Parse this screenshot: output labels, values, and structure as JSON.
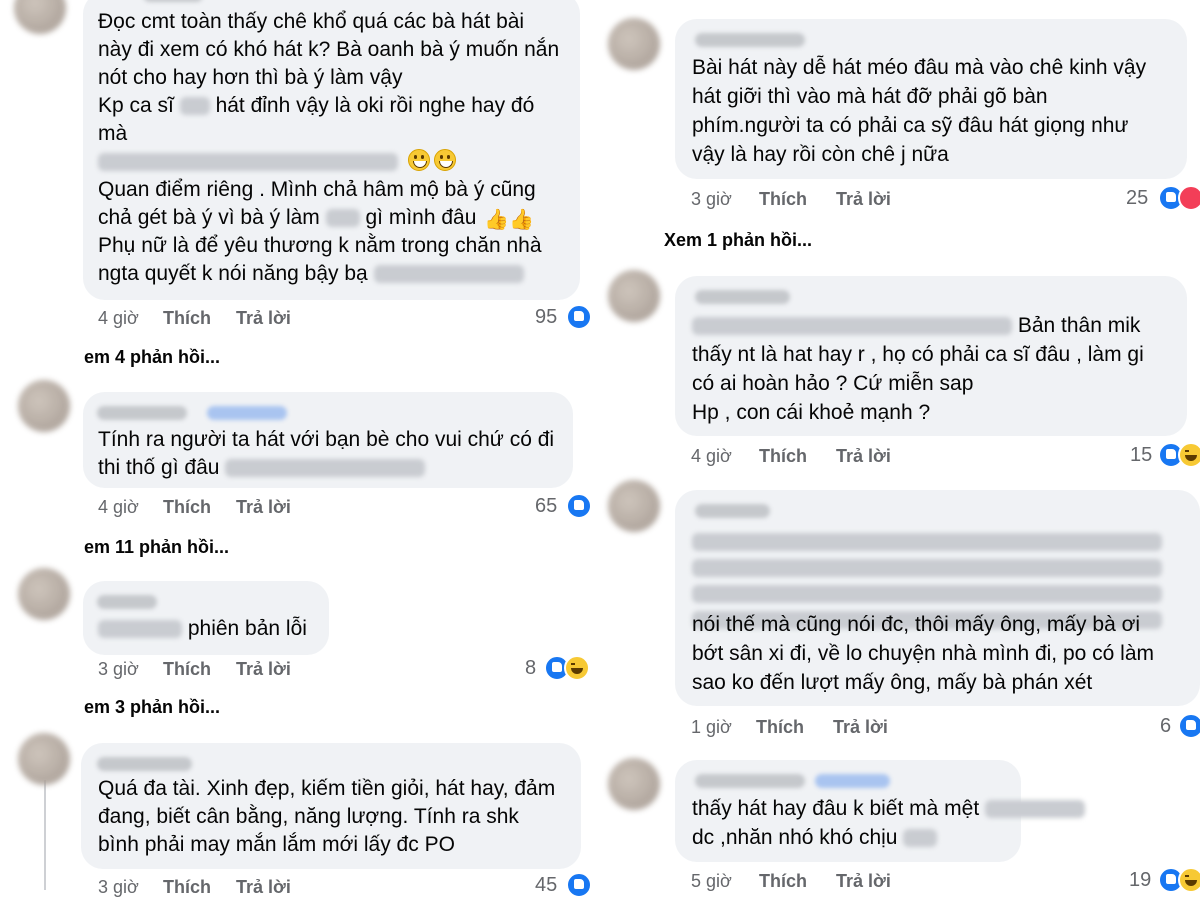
{
  "left": {
    "comments": [
      {
        "lines": [
          "Đọc cmt toàn thấy chê khổ quá các bà hát bài",
          "này đi xem có khó hát k? Bà oanh bà ý muốn nắn",
          "nót cho hay hơn thì bà ý làm vậy",
          "Kp ca sĩ",
          "hát đỉnh vậy là oki rồi nghe hay đó",
          "mà",
          "Quan điểm riêng . Mình chả hâm mộ bà ý cũng",
          "chả gét bà ý vì bà ý làm",
          "gì mình đâu",
          "Phụ nữ là để yêu thương k nằm trong chăn nhà",
          "ngta quyết k nói năng bậy bạ"
        ],
        "time": "4 giờ",
        "like": "Thích",
        "reply": "Trả lời",
        "reactions": "95",
        "more_replies": "em 4 phản hồi..."
      },
      {
        "lines": [
          "Tính ra người ta hát với bạn bè cho vui chứ có đi",
          "thi thố gì đâu"
        ],
        "time": "4 giờ",
        "like": "Thích",
        "reply": "Trả lời",
        "reactions": "65",
        "more_replies": "em 11 phản hồi..."
      },
      {
        "lines": [
          "phiên bản lỗi"
        ],
        "time": "3 giờ",
        "like": "Thích",
        "reply": "Trả lời",
        "reactions": "8",
        "more_replies": "em 3 phản hồi..."
      },
      {
        "lines": [
          "Quá đa tài. Xinh đẹp, kiếm tiền giỏi, hát hay, đảm",
          "đang, biết cân bằng, năng lượng. Tính ra shk",
          "bình phải may mắn lắm mới lấy đc PO"
        ],
        "time": "3 giờ",
        "like": "Thích",
        "reply": "Trả lời",
        "reactions": "45"
      }
    ]
  },
  "right": {
    "comments": [
      {
        "lines": [
          "Bài hát này dễ hát méo đâu mà vào chê kinh vậy",
          "hát giỡi thì vào mà hát đỡ phải gõ bàn",
          "phím.người ta có phải ca sỹ đâu hát  giọng như",
          "vậy là hay rồi còn chê j nữa"
        ],
        "time": "3 giờ",
        "like": "Thích",
        "reply": "Trả lời",
        "reactions": "25",
        "more_replies": "Xem 1 phản hồi..."
      },
      {
        "lines": [
          "Bản thân mik",
          "thấy nt là hat hay r , họ có phải ca sĩ đâu , làm gi",
          "có ai hoàn hảo ? Cứ miễn sap",
          "Hp , con cái khoẻ mạnh ?"
        ],
        "time": "4 giờ",
        "like": "Thích",
        "reply": "Trả lời",
        "reactions": "15"
      },
      {
        "lines": [
          "nói thế mà cũng nói đc, thôi mấy ông, mấy bà ơi",
          "bớt sân xi đi, về lo chuyện nhà mình đi, po có làm",
          "sao ko đến lượt mấy ông, mấy bà phán xét"
        ],
        "time": "1 giờ",
        "like": "Thích",
        "reply": "Trả lời",
        "reactions": "6"
      },
      {
        "lines": [
          "thấy hát hay đâu k biết mà mệt",
          "dc ,nhăn nhó khó chịu"
        ],
        "time": "5 giờ",
        "like": "Thích",
        "reply": "Trả lời",
        "reactions": "19"
      }
    ]
  },
  "icons": {
    "like": "like-reaction-icon",
    "haha": "haha-reaction-icon",
    "love": "love-reaction-icon",
    "grin": "grinning-face-emoji",
    "thumbs_up": "thumbs-up-emoji"
  },
  "colors": {
    "bubble": "#f0f2f5",
    "meta": "#65676b",
    "like": "#1877f2",
    "haha": "#f7c934",
    "love": "#f33e58"
  }
}
